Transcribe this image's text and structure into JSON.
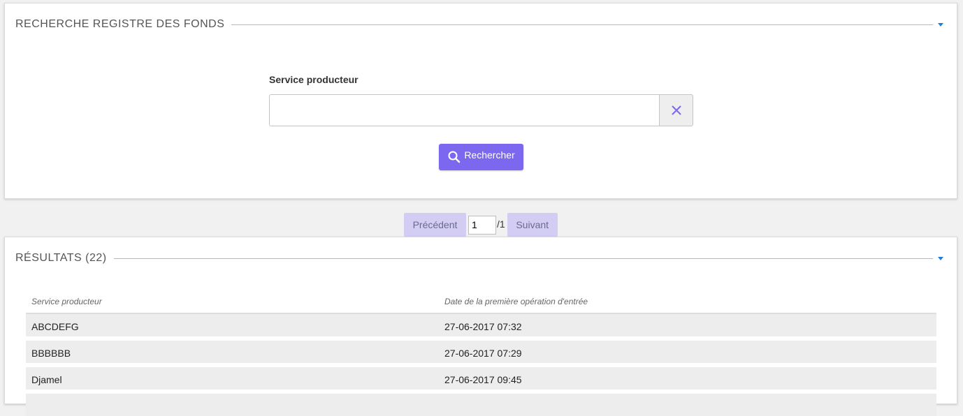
{
  "search_panel": {
    "title": "RECHERCHE REGISTRE DES FONDS",
    "field_label": "Service producteur",
    "input_value": "",
    "search_button": "Rechercher"
  },
  "pager": {
    "prev_label": "Précédent",
    "current_page": "1",
    "total": "/1",
    "next_label": "Suivant"
  },
  "results_panel": {
    "title": "RÉSULTATS (22)",
    "columns": [
      "Service producteur",
      "Date de la première opération d'entrée"
    ],
    "rows": [
      {
        "service": "ABCDEFG",
        "date": "27-06-2017 07:32"
      },
      {
        "service": "BBBBBB",
        "date": "27-06-2017 07:29"
      },
      {
        "service": "Djamel",
        "date": "27-06-2017 09:45"
      },
      {
        "service": "",
        "date": ""
      }
    ]
  },
  "colors": {
    "accent": "#7b68ee",
    "pager_button": "#d4cdf3",
    "caret": "#1e7dd8"
  },
  "icons": {
    "clear": "close-icon",
    "search": "search-icon",
    "toggle": "caret-down-icon"
  }
}
